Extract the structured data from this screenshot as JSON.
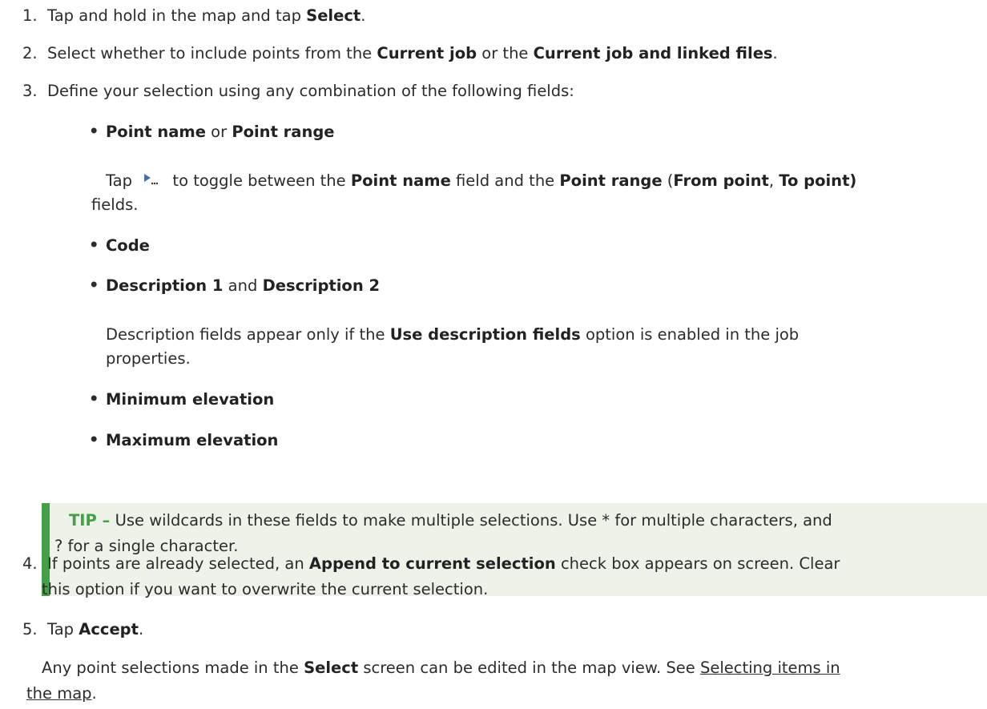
{
  "steps": {
    "s1": {
      "num": "1.",
      "pre": "Tap and hold in the map and tap ",
      "b1": "Select",
      "post": "."
    },
    "s2": {
      "num": "2.",
      "pre": "Select whether to include points from the ",
      "b1": "Current job",
      "mid": " or the ",
      "b2": "Current job and linked files",
      "post": "."
    },
    "s3": {
      "num": "3.",
      "text": "Define your selection using any combination of the following fields:"
    },
    "s4": {
      "num": "4.",
      "pre": "If points are already selected, an ",
      "b1": "Append to current selection",
      "post": " check box appears on screen. Clear",
      "line2": "this option if you want to overwrite the current selection."
    },
    "s5": {
      "num": "5.",
      "pre": "Tap ",
      "b1": "Accept",
      "post": "."
    }
  },
  "fields": {
    "f1": {
      "b1": "Point name",
      "mid": " or ",
      "b2": "Point range"
    },
    "f1_note": {
      "pre": "Tap",
      "t1": " to toggle between the ",
      "b1": "Point name",
      "t2": " field and the ",
      "b2": "Point range",
      "t3": " (",
      "b3": "From point",
      "t4": ", ",
      "b4": "To point)",
      "line2": "fields."
    },
    "f2": {
      "b1": "Code"
    },
    "f3": {
      "b1": "Description 1",
      "mid": " and ",
      "b2": "Description 2"
    },
    "f3_note": {
      "pre": "Description fields appear only if the ",
      "b1": "Use description fields",
      "post": " option is enabled in the job",
      "line2": "properties."
    },
    "f4": {
      "b1": "Minimum elevation"
    },
    "f5": {
      "b1": "Maximum elevation"
    }
  },
  "tip": {
    "label": "TIP –",
    "line1": " Use wildcards in these fields to make multiple selections. Use * for multiple characters, and",
    "line2": "? for a single character."
  },
  "final": {
    "pre": "Any point selections made in the ",
    "b1": "Select",
    "mid": " screen can be edited in the map view. See ",
    "link1": "Selecting items in",
    "link2": "the map",
    "post": "."
  },
  "icons": {
    "toggle": "play-toggle-icon"
  }
}
